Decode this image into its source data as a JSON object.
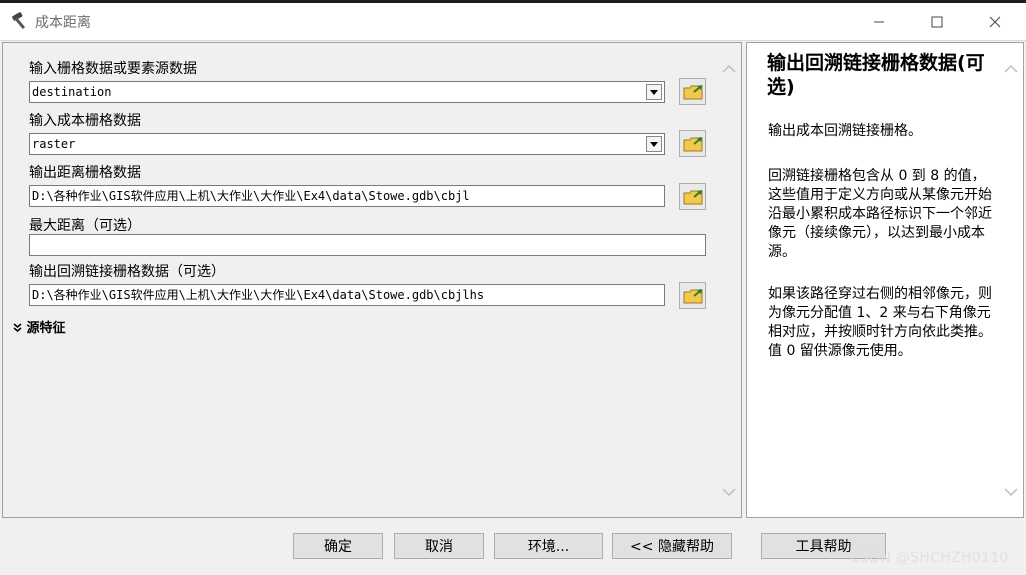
{
  "window": {
    "title": "成本距离",
    "icon": "hammer-icon"
  },
  "form": {
    "fields": [
      {
        "label": "输入栅格数据或要素源数据",
        "value": "destination",
        "type": "combo"
      },
      {
        "label": "输入成本栅格数据",
        "value": "raster",
        "type": "combo"
      },
      {
        "label": "输出距离栅格数据",
        "value": "D:\\各种作业\\GIS软件应用\\上机\\大作业\\大作业\\Ex4\\data\\Stowe.gdb\\cbjl",
        "type": "text"
      },
      {
        "label": "最大距离（可选）",
        "value": "",
        "type": "text"
      },
      {
        "label": "输出回溯链接栅格数据（可选）",
        "value": "D:\\各种作业\\GIS软件应用\\上机\\大作业\\大作业\\Ex4\\data\\Stowe.gdb\\cbjlhs",
        "type": "text"
      }
    ],
    "section_toggle": "源特征"
  },
  "help": {
    "title": "输出回溯链接栅格数据(可选)",
    "paragraphs": [
      "输出成本回溯链接栅格。",
      "回溯链接栅格包含从 0 到 8 的值，这些值用于定义方向或从某像元开始沿最小累积成本路径标识下一个邻近像元（接续像元），以达到最小成本源。",
      "如果该路径穿过右侧的相邻像元，则为像元分配值 1、2 来与右下角像元相对应，并按顺时针方向依此类推。值 0 留供源像元使用。"
    ]
  },
  "buttons": {
    "ok": "确定",
    "cancel": "取消",
    "environments": "环境...",
    "hide_help": "<< 隐藏帮助",
    "tool_help": "工具帮助"
  },
  "watermark": "CSDN @SHCHZH0110",
  "colors": {
    "folder": "#f2c94c",
    "folder_arrow": "#2e7d32"
  }
}
